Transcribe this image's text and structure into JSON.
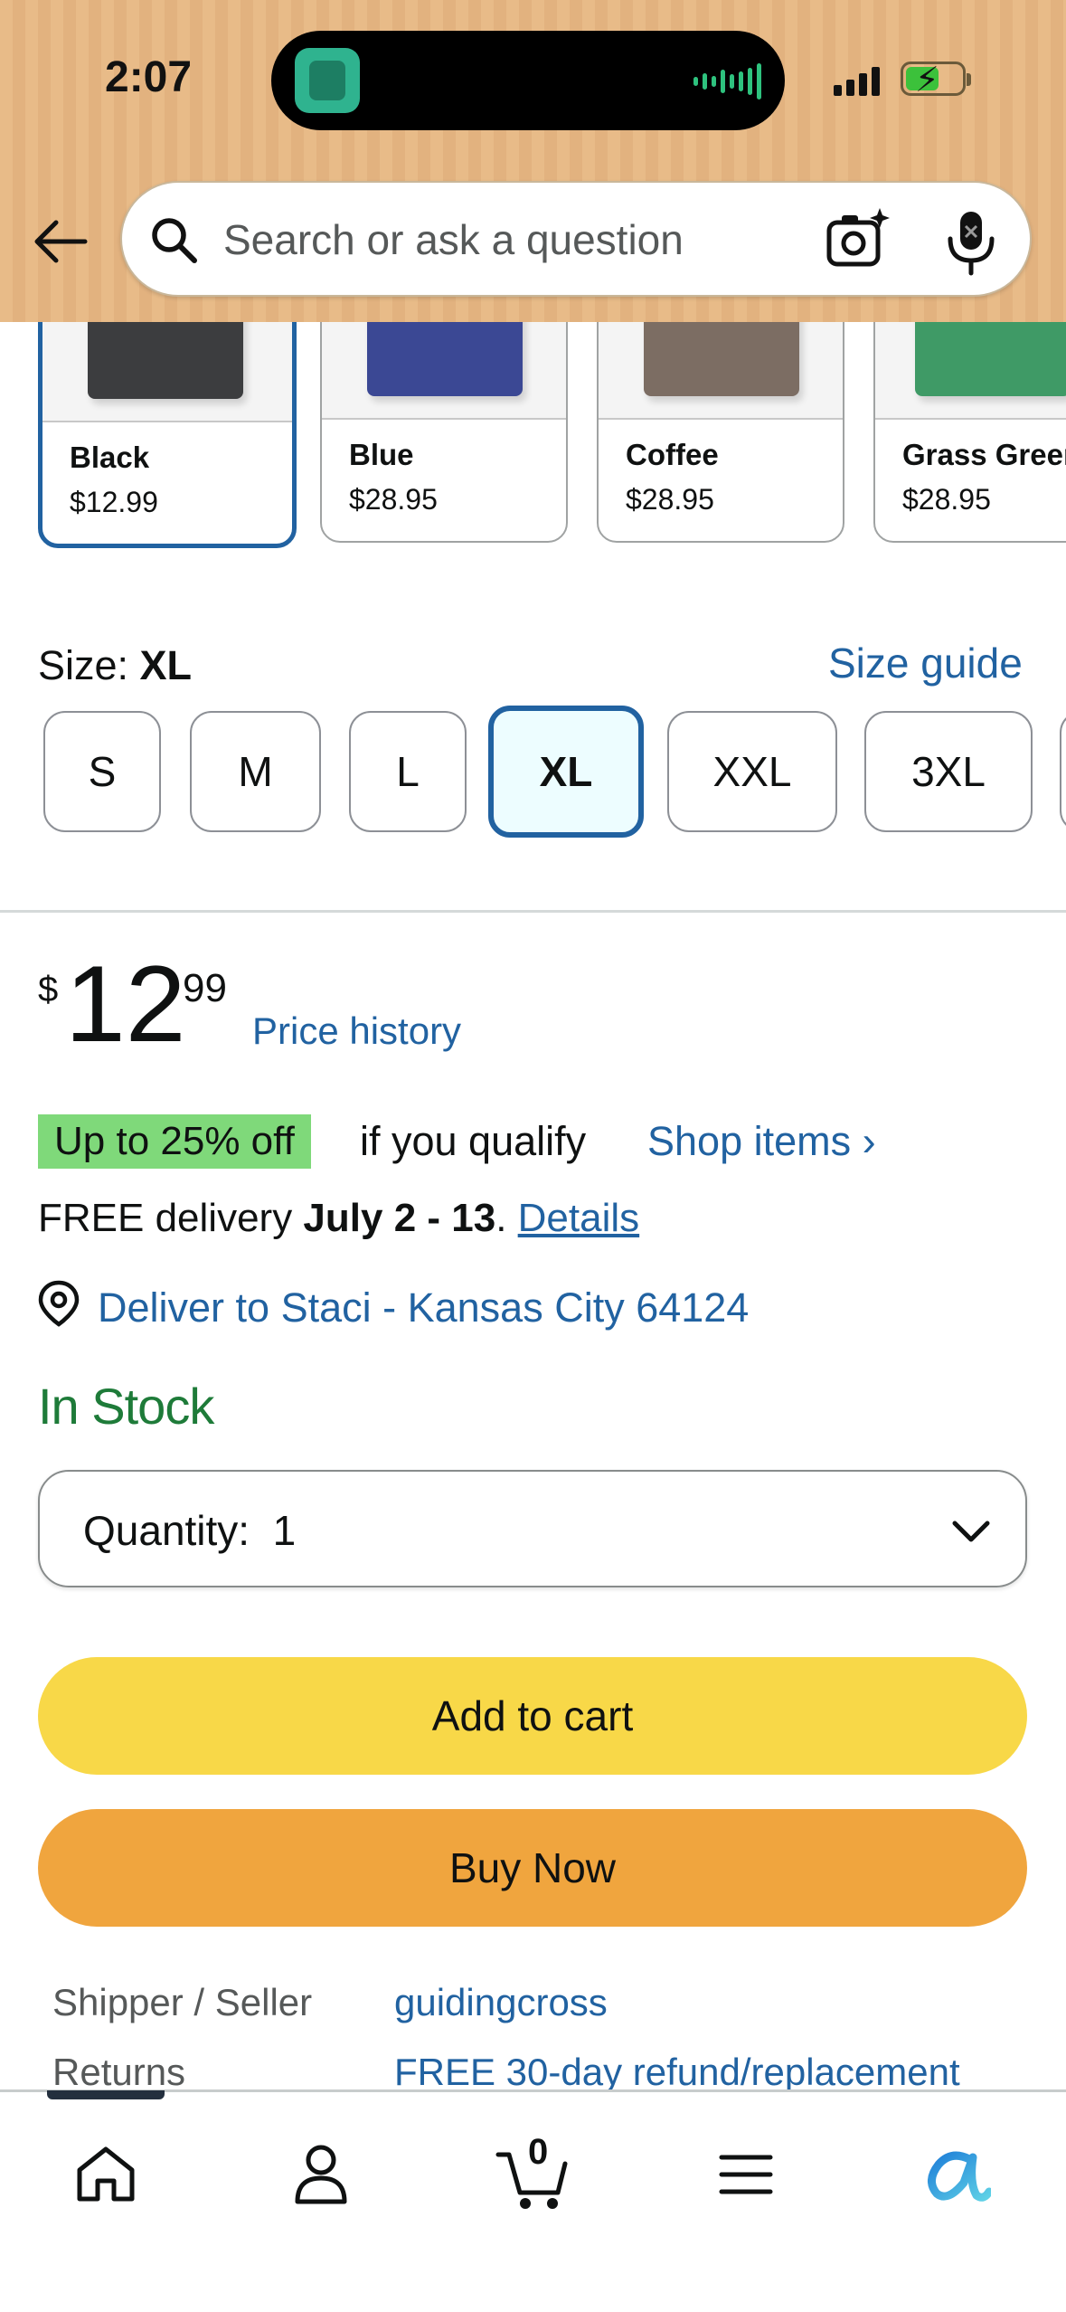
{
  "status_bar": {
    "time": "2:07"
  },
  "search": {
    "placeholder": "Search or ask a question"
  },
  "swatches": [
    {
      "name": "Black",
      "price": "$12.99",
      "color": "#3c3d3f",
      "selected": true
    },
    {
      "name": "Blue",
      "price": "$28.95",
      "color": "#3b4894",
      "selected": false
    },
    {
      "name": "Coffee",
      "price": "$28.95",
      "color": "#7c6d63",
      "selected": false
    },
    {
      "name": "Grass Green",
      "price": "$28.95",
      "color": "#3f9a66",
      "selected": false
    }
  ],
  "size": {
    "label": "Size: ",
    "selected": "XL",
    "guide_link": "Size guide",
    "options": [
      "S",
      "M",
      "L",
      "XL",
      "XXL",
      "3XL"
    ]
  },
  "price": {
    "currency": "$",
    "whole": "12",
    "fraction": "99",
    "history_link": "Price history"
  },
  "deal": {
    "badge": "Up to 25% off",
    "text": "if you qualify",
    "link": "Shop items ›"
  },
  "delivery": {
    "prefix": "FREE delivery ",
    "dates": "July 2 - 13",
    "separator": ". ",
    "details_link": "Details",
    "deliver_to": "Deliver to Staci - Kansas City 64124"
  },
  "stock": "In Stock",
  "quantity": {
    "label": "Quantity:",
    "value": "1"
  },
  "buttons": {
    "add_to_cart": "Add to cart",
    "buy_now": "Buy Now"
  },
  "info": [
    {
      "label": "Shipper / Seller",
      "value": "guidingcross"
    },
    {
      "label": "Returns",
      "value": "FREE 30-day refund/replacement"
    }
  ],
  "bottom_nav": {
    "cart_count": "0"
  },
  "colors": {
    "header_bg": "#e8bb88",
    "link": "#2162a1",
    "selected_border": "#2162a1",
    "in_stock": "#1e7b39",
    "deal_badge": "#7fd97a",
    "add_to_cart": "#f8d848",
    "buy_now": "#f0a53e"
  },
  "icons": [
    "back-arrow-icon",
    "search-icon",
    "camera-icon",
    "microphone-icon",
    "location-pin-icon",
    "chevron-down-icon",
    "home-icon",
    "account-icon",
    "cart-icon",
    "menu-icon",
    "rufus-icon"
  ]
}
